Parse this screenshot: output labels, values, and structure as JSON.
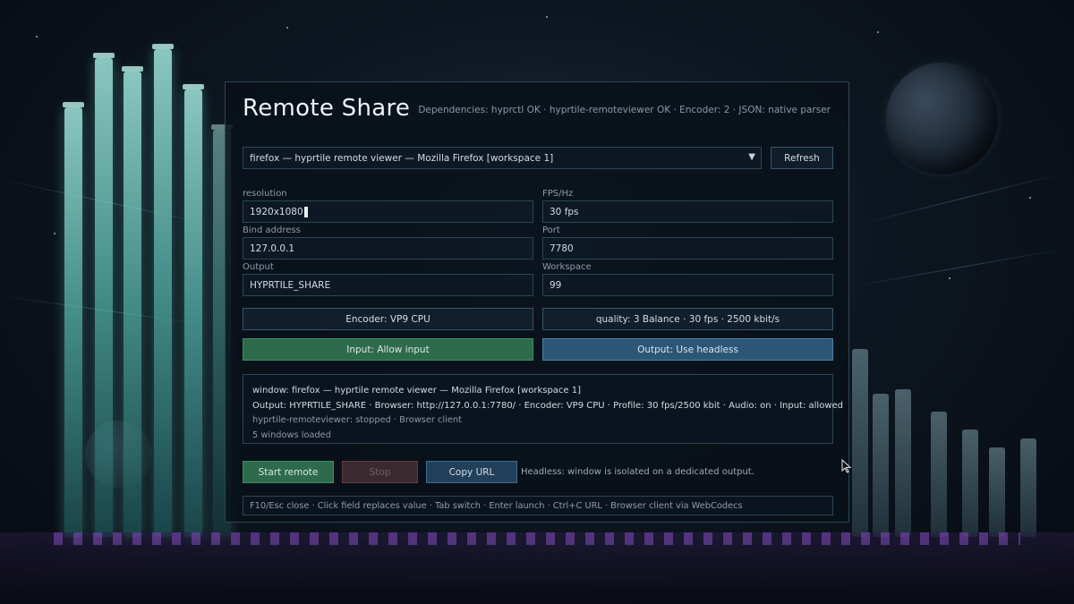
{
  "app": {
    "title": "Remote Share",
    "dependencies": "Dependencies: hyprctl OK · hyprtile-remoteviewer OK · Encoder: 2 · JSON: native parser"
  },
  "window_select": {
    "value": "firefox — hyprtile remote viewer — Mozilla Firefox [workspace 1]",
    "arrow": "▼",
    "refresh_label": "Refresh"
  },
  "fields": {
    "resolution_label": "resolution",
    "resolution_value": "1920x1080",
    "fps_label": "FPS/Hz",
    "fps_value": "30 fps",
    "bind_label": "Bind address",
    "bind_value": "127.0.0.1",
    "port_label": "Port",
    "port_value": "7780",
    "output_label": "Output",
    "output_value": "HYPRTILE_SHARE",
    "workspace_label": "Workspace",
    "workspace_value": "99"
  },
  "toggles": {
    "encoder": "Encoder: VP9 CPU",
    "quality": "quality: 3 Balance · 30 fps · 2500 kbit/s",
    "input": "Input: Allow input",
    "output": "Output: Use headless"
  },
  "info": {
    "window": "window: firefox — hyprtile remote viewer — Mozilla Firefox [workspace 1]",
    "summary": "Output: HYPRTILE_SHARE · Browser: http://127.0.0.1:7780/ · Encoder: VP9 CPU · Profile: 30 fps/2500 kbit · Audio: on · Input: allowed",
    "status": "hyprtile-remoteviewer: stopped · Browser client",
    "windows_loaded": "5 windows loaded"
  },
  "actions": {
    "start": "Start remote",
    "stop": "Stop",
    "copy": "Copy URL",
    "hint": "Headless: window is isolated on a dedicated output."
  },
  "footer": {
    "shortcuts": "F10/Esc close · Click field replaces value · Tab switch · Enter launch · Ctrl+C URL · Browser client via WebCodecs"
  },
  "colors": {
    "accent_green": "#2e6a4c",
    "accent_blue": "#2c5676",
    "stop_red": "#6a3a42",
    "panel_border": "#2e4656"
  }
}
